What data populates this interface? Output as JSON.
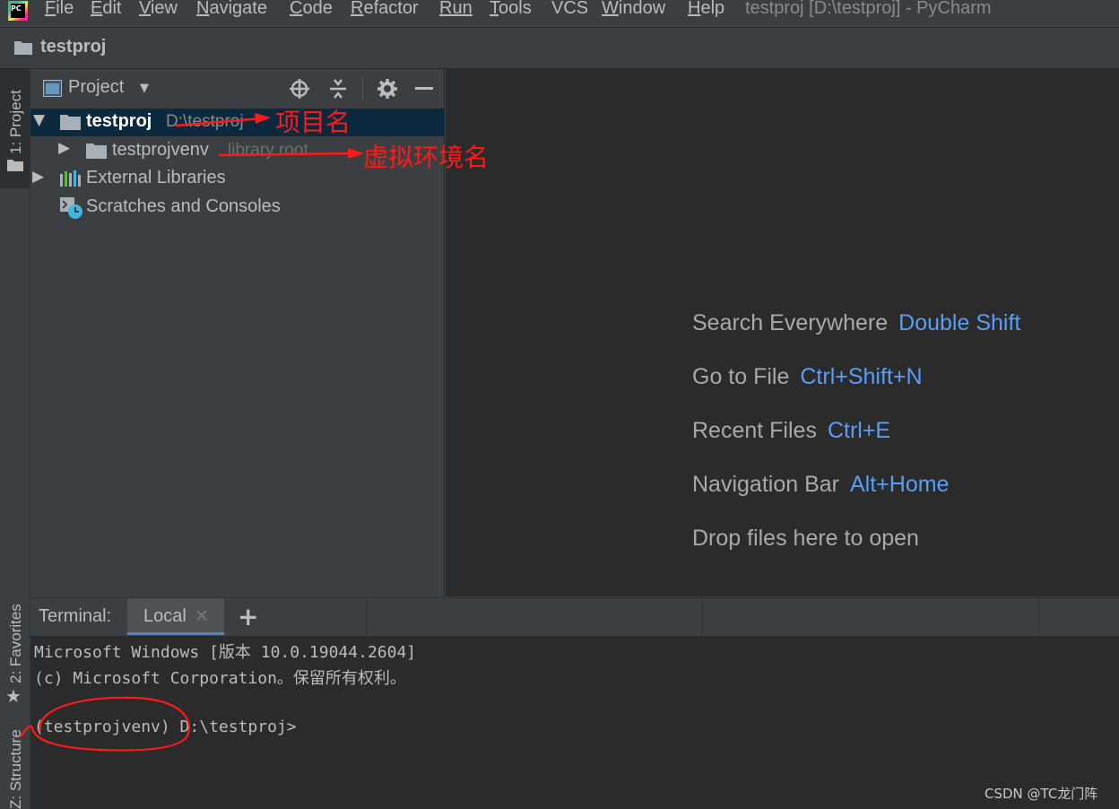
{
  "app": {
    "logo_text": "PC",
    "window_title": "testproj [D:\\testproj] - PyCharm"
  },
  "menu": [
    {
      "mnemonic": "F",
      "rest": "ile"
    },
    {
      "mnemonic": "E",
      "rest": "dit"
    },
    {
      "mnemonic": "V",
      "rest": "iew"
    },
    {
      "mnemonic": "N",
      "rest": "avigate"
    },
    {
      "mnemonic": "C",
      "rest": "ode"
    },
    {
      "mnemonic": "R",
      "rest": "efactor"
    },
    {
      "mnemonic": "",
      "rest": "Run"
    },
    {
      "mnemonic": "T",
      "rest": "ools"
    },
    {
      "mnemonic": "",
      "rest": "VCS"
    },
    {
      "mnemonic": "W",
      "rest": "indow"
    },
    {
      "mnemonic": "H",
      "rest": "elp"
    }
  ],
  "navbar": {
    "project_name": "testproj"
  },
  "tool_stripe": {
    "project_tab": "1: Project",
    "favorites_tab": "2: Favorites",
    "structure_tab": "Z: Structure"
  },
  "project_panel": {
    "title": "Project",
    "tree": {
      "root_name": "testproj",
      "root_path": "D:\\testproj",
      "venv_name": "testprojvenv",
      "venv_note": "library root",
      "external_libraries": "External Libraries",
      "scratches": "Scratches and Consoles"
    }
  },
  "editor_hints": [
    {
      "label": "Search Everywhere",
      "key": "Double Shift"
    },
    {
      "label": "Go to File",
      "key": "Ctrl+Shift+N"
    },
    {
      "label": "Recent Files",
      "key": "Ctrl+E"
    },
    {
      "label": "Navigation Bar",
      "key": "Alt+Home"
    },
    {
      "label": "Drop files here to open",
      "key": ""
    }
  ],
  "terminal": {
    "label": "Terminal:",
    "tab": "Local",
    "lines": [
      "Microsoft Windows [版本 10.0.19044.2604]",
      "(c) Microsoft Corporation。保留所有权利。",
      "",
      "(testprojvenv) D:\\testproj>"
    ]
  },
  "annotations": {
    "project_name_label": "项目名",
    "venv_name_label": "虚拟环境名",
    "color": "#ff1a1a"
  },
  "watermark": "CSDN @TC龙门阵",
  "colors": {
    "background": "#3c3f41",
    "editor_bg": "#2b2b2b",
    "accent": "#589df6",
    "selection": "#0d293e"
  }
}
